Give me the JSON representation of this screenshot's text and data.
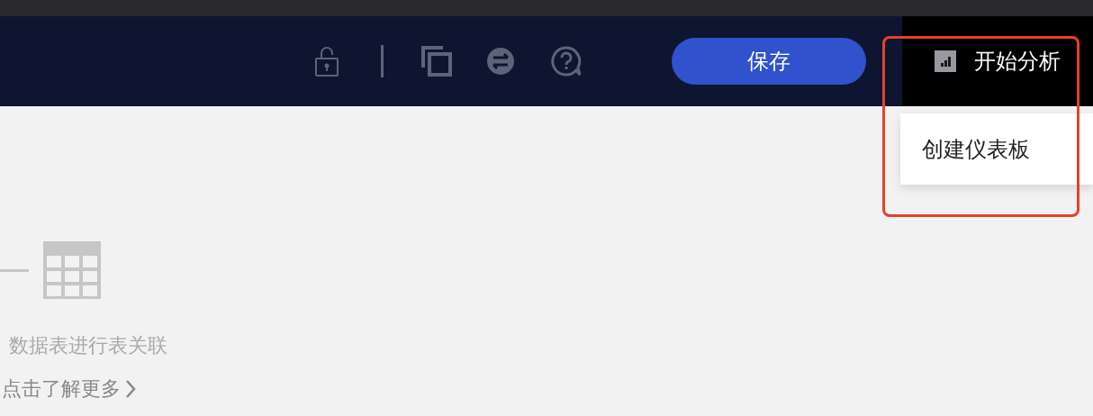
{
  "header": {
    "save_button": "保存",
    "analyze_menu": {
      "label": "开始分析",
      "expanded": true,
      "items": [
        {
          "label": "创建仪表板"
        }
      ]
    }
  },
  "empty_state": {
    "description": "数据表进行表关联",
    "link": "点击了解更多"
  }
}
